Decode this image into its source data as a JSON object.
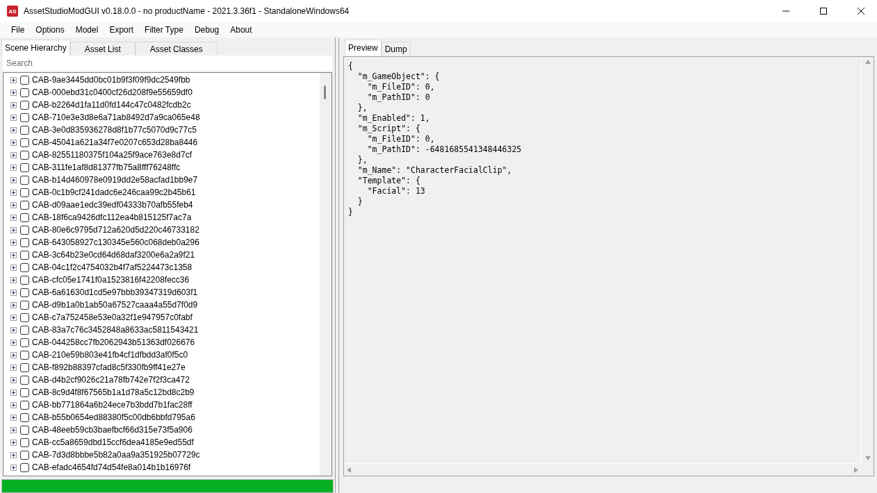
{
  "window": {
    "title": "AssetStudioModGUI v0.18.0.0 - no productName - 2021.3.36f1 - StandaloneWindows64",
    "logo": "AS"
  },
  "menu": [
    "File",
    "Options",
    "Model",
    "Export",
    "Filter Type",
    "Debug",
    "About"
  ],
  "left_tabs": [
    {
      "label": "Scene Hierarchy",
      "selected": true
    },
    {
      "label": "Asset List",
      "selected": false
    },
    {
      "label": "Asset Classes",
      "selected": false
    }
  ],
  "search": {
    "placeholder": "Search"
  },
  "tree": [
    {
      "label": "CAB-9ae3445dd0bc01b9f3f09f9dc2549fbb",
      "checked": false,
      "expanded": false
    },
    {
      "label": "CAB-000ebd31c0400cf26d208f9e55659df0",
      "checked": false,
      "expanded": false
    },
    {
      "label": "CAB-b2264d1fa11d0fd144c47c0482fcdb2c",
      "checked": false,
      "expanded": false
    },
    {
      "label": "CAB-710e3e3d8e6a71ab8492d7a9ca065e48",
      "checked": false,
      "expanded": false
    },
    {
      "label": "CAB-3e0d835936278d8f1b77c5070d9c77c5",
      "checked": false,
      "expanded": false
    },
    {
      "label": "CAB-45041a621a34f7e0207c653d28ba8446",
      "checked": false,
      "expanded": false
    },
    {
      "label": "CAB-82551180375f104a25f9ace763e8d7cf",
      "checked": false,
      "expanded": false
    },
    {
      "label": "CAB-311fe1af8d81377fb75a8fff76248ffc",
      "checked": false,
      "expanded": false
    },
    {
      "label": "CAB-b14d460978e0919dd2e58acfad1bb9e7",
      "checked": false,
      "expanded": false
    },
    {
      "label": "CAB-0c1b9cf241dadc6e246caa99c2b45b61",
      "checked": false,
      "expanded": false
    },
    {
      "label": "CAB-d09aae1edc39edf04333b70afb55feb4",
      "checked": false,
      "expanded": false
    },
    {
      "label": "CAB-18f6ca9426dfc112ea4b815125f7ac7a",
      "checked": false,
      "expanded": false
    },
    {
      "label": "CAB-80e6c9795d712a620d5d220c46733182",
      "checked": false,
      "expanded": false
    },
    {
      "label": "CAB-643058927c130345e560c068deb0a296",
      "checked": false,
      "expanded": false
    },
    {
      "label": "CAB-3c64b23e0cd64d68daf3200e6a2a9f21",
      "checked": false,
      "expanded": false
    },
    {
      "label": "CAB-04c1f2c4754032b4f7af5224473c1358",
      "checked": false,
      "expanded": false
    },
    {
      "label": "CAB-cfc05e1741f0a1523816f42208fecc36",
      "checked": false,
      "expanded": false
    },
    {
      "label": "CAB-6a61630d1cd5e97bbb39347319d603f1",
      "checked": false,
      "expanded": false
    },
    {
      "label": "CAB-d9b1a0b1ab50a67527caaa4a55d7f0d9",
      "checked": false,
      "expanded": false
    },
    {
      "label": "CAB-c7a752458e53e0a32f1e947957c0fabf",
      "checked": false,
      "expanded": false
    },
    {
      "label": "CAB-83a7c76c3452848a8633ac5811543421",
      "checked": false,
      "expanded": false
    },
    {
      "label": "CAB-044258cc7fb2062943b51363df026676",
      "checked": false,
      "expanded": false
    },
    {
      "label": "CAB-210e59b803e41fb4cf1dfbdd3af0f5c0",
      "checked": false,
      "expanded": false
    },
    {
      "label": "CAB-f892b88397cfad8c5f330fb9ff41e27e",
      "checked": false,
      "expanded": false
    },
    {
      "label": "CAB-d4b2cf9026c21a78fb742e7f2f3ca472",
      "checked": false,
      "expanded": false
    },
    {
      "label": "CAB-8c9d4f8f67565b1a1d78a5c12bd8c2b9",
      "checked": false,
      "expanded": false
    },
    {
      "label": "CAB-bb771864a6b24ece7b3bdd7b1fac28ff",
      "checked": false,
      "expanded": false
    },
    {
      "label": "CAB-b55b0654ed88380f5c00db6bbfd795a6",
      "checked": false,
      "expanded": false
    },
    {
      "label": "CAB-48eeb59cb3baefbcf66d315e73f5a906",
      "checked": false,
      "expanded": false
    },
    {
      "label": "CAB-cc5a8659dbd15ccf6dea4185e9ed55df",
      "checked": false,
      "expanded": false
    },
    {
      "label": "CAB-7d3d8bbbe5b82a0aa9a351925b07729c",
      "checked": false,
      "expanded": false
    },
    {
      "label": "CAB-efadc4654fd74d54fe8a014b1b16976f",
      "checked": false,
      "expanded": false
    }
  ],
  "progress": {
    "level": 1
  },
  "right_tabs": [
    {
      "label": "Preview",
      "selected": true
    },
    {
      "label": "Dump",
      "selected": false
    }
  ],
  "preview_lines": [
    "{",
    "  \"m_GameObject\": {",
    "    \"m_FileID\": 0,",
    "    \"m_PathID\": 0",
    "  },",
    "  \"m_Enabled\": 1,",
    "  \"m_Script\": {",
    "    \"m_FileID\": 0,",
    "    \"m_PathID\": -6481685541348446325",
    "  },",
    "  \"m_Name\": \"CharacterFacialClip\",",
    "  \"Template\": {",
    "    \"Facial\": 13",
    "  }",
    "}"
  ]
}
